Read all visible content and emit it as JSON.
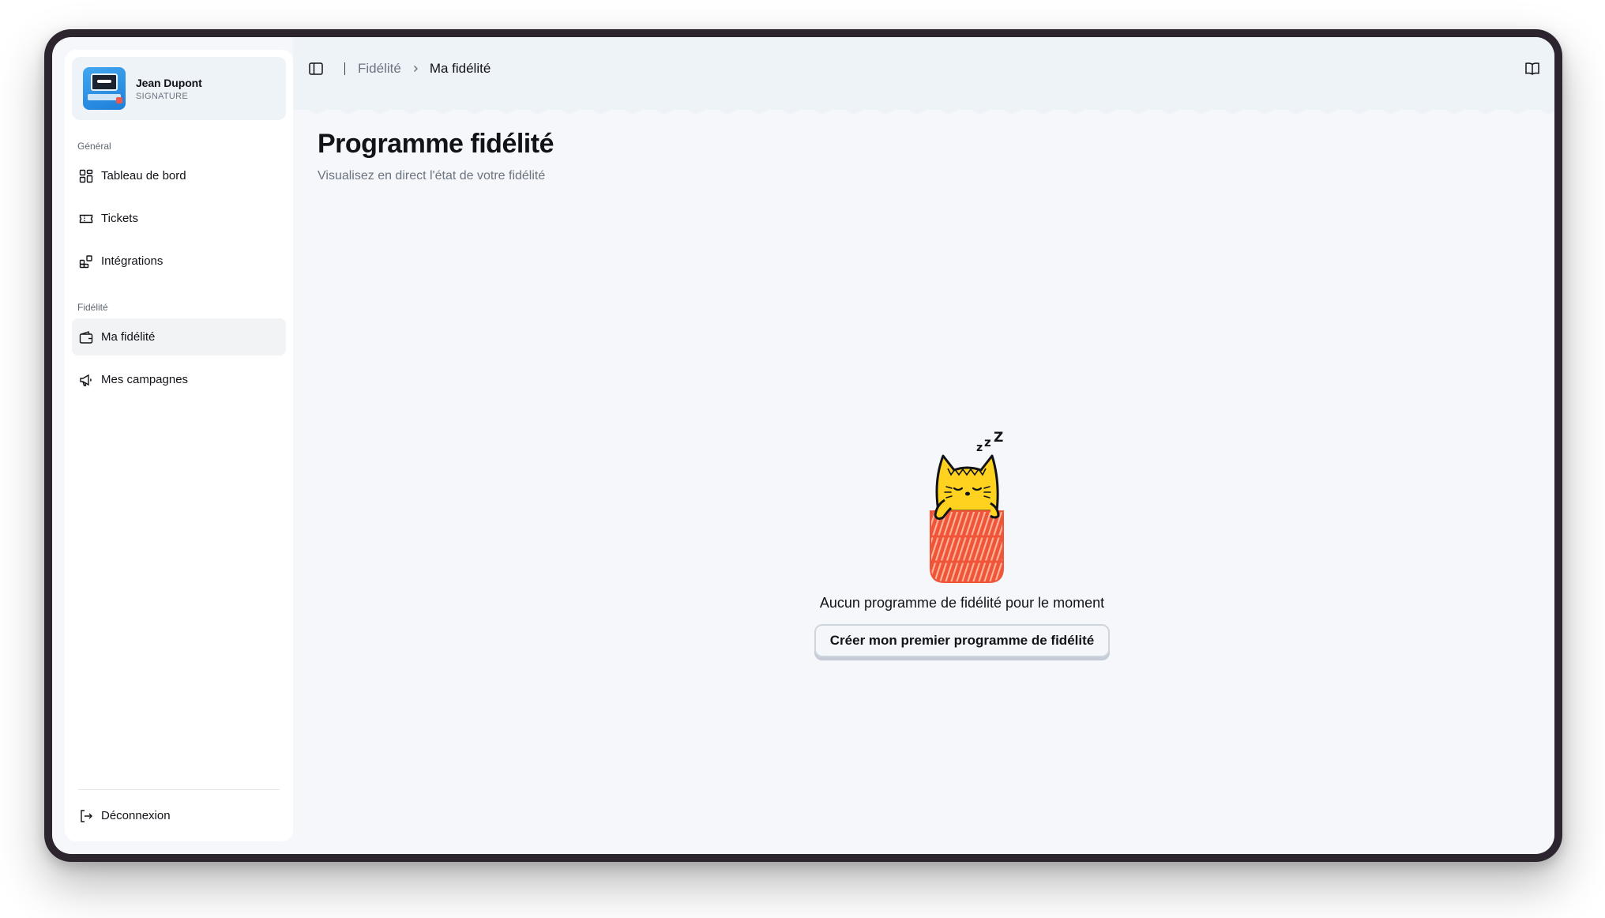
{
  "profile": {
    "name": "Jean Dupont",
    "plan": "SIGNATURE"
  },
  "sidebar": {
    "sections": [
      {
        "label": "Général"
      },
      {
        "label": "Fidélité"
      }
    ],
    "items": [
      {
        "label": "Tableau de bord",
        "icon": "dashboard-icon"
      },
      {
        "label": "Tickets",
        "icon": "ticket-icon"
      },
      {
        "label": "Intégrations",
        "icon": "integrations-icon"
      },
      {
        "label": "Ma fidélité",
        "icon": "wallet-icon",
        "active": true
      },
      {
        "label": "Mes campagnes",
        "icon": "megaphone-icon"
      }
    ],
    "logout": {
      "label": "Déconnexion",
      "icon": "logout-icon"
    }
  },
  "breadcrumb": {
    "parent": "Fidélité",
    "current": "Ma fidélité"
  },
  "page": {
    "title": "Programme fidélité",
    "subtitle": "Visualisez en direct l'état de votre fidélité"
  },
  "empty_state": {
    "message": "Aucun programme de fidélité pour le moment",
    "cta": "Créer mon premier programme de fidélité",
    "illustration": "sleeping-cat"
  },
  "colors": {
    "accent_orange": "#f0553a",
    "cat_yellow": "#ffd21f",
    "topbar_bg": "#eef3f8",
    "frame": "#2c2530"
  }
}
